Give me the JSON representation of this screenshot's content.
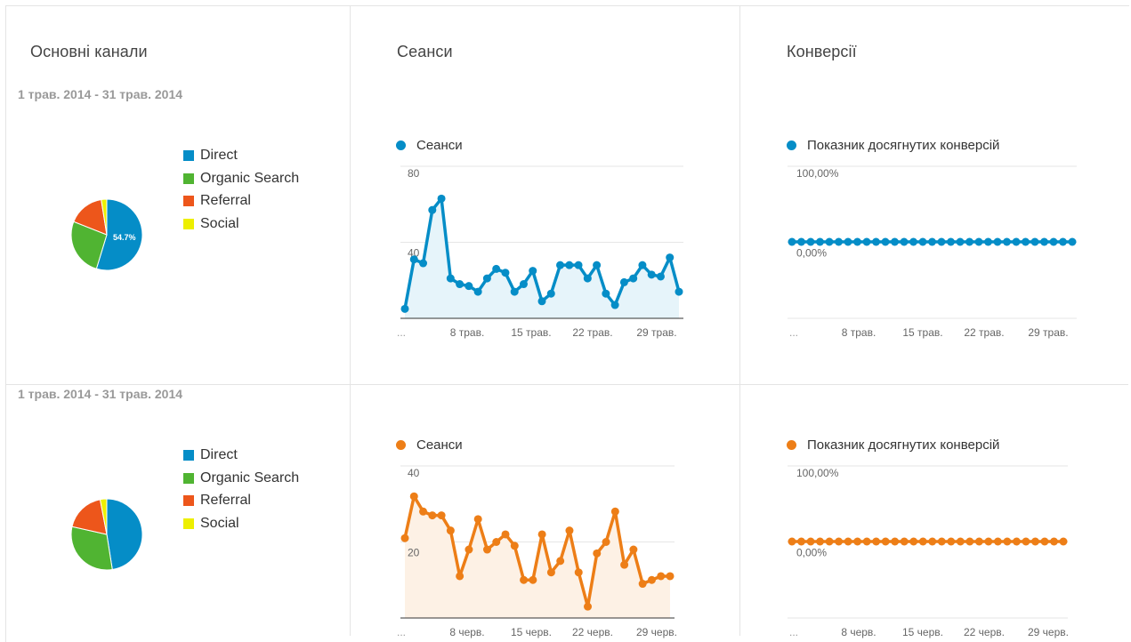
{
  "colors": {
    "direct": "#058dc7",
    "organic": "#50b432",
    "referral": "#ed561b",
    "social": "#edef00",
    "blue": "#058dc7",
    "orange": "#ed7e17",
    "blue_fill": "#e6f4fa",
    "orange_fill": "#fdf1e5"
  },
  "columns": {
    "channels_title": "Основні канали",
    "sessions_title": "Сеанси",
    "conversions_title": "Конверсії"
  },
  "rows": [
    {
      "date_range": "1 трав. 2014 - 31 трав. 2014",
      "pie_legend": [
        "Direct",
        "Organic Search",
        "Referral",
        "Social"
      ],
      "pie_label": "54.7%",
      "sessions_legend": "Сеанси",
      "conversions_legend": "Показник досягнутих конверсій"
    },
    {
      "date_range": "1 трав. 2014 - 31 трав. 2014",
      "pie_legend": [
        "Direct",
        "Organic Search",
        "Referral",
        "Social"
      ],
      "pie_label": "",
      "sessions_legend": "Сеанси",
      "conversions_legend": "Показник досягнутих конверсій"
    }
  ],
  "chart_data": [
    {
      "type": "pie",
      "categories": [
        "Direct",
        "Organic Search",
        "Referral",
        "Social"
      ],
      "values": [
        54.7,
        26.3,
        16.5,
        2.5
      ],
      "data_labels": [
        "54.7%"
      ]
    },
    {
      "type": "area",
      "legend": [
        "Сеанси"
      ],
      "y_ticks": [
        "80",
        "40"
      ],
      "ylim": [
        0,
        80
      ],
      "x_ticks": [
        "...",
        "8 трав.",
        "15 трав.",
        "22 трав.",
        "29 трав."
      ],
      "series": [
        {
          "name": "Сеанси",
          "values": [
            5,
            31,
            29,
            57,
            63,
            21,
            18,
            17,
            14,
            21,
            26,
            24,
            14,
            18,
            25,
            9,
            13,
            28,
            28,
            28,
            21,
            28,
            13,
            7,
            19,
            21,
            28,
            23,
            22,
            32,
            14
          ]
        }
      ]
    },
    {
      "type": "line",
      "legend": [
        "Показник досягнутих конверсій"
      ],
      "y_ticks": [
        "100,00%",
        "0,00%"
      ],
      "ylim": [
        0,
        100
      ],
      "x_ticks": [
        "...",
        "8 трав.",
        "15 трав.",
        "22 трав.",
        "29 трав."
      ],
      "series": [
        {
          "name": "Показник досягнутих конверсій",
          "values": [
            0,
            0,
            0,
            0,
            0,
            0,
            0,
            0,
            0,
            0,
            0,
            0,
            0,
            0,
            0,
            0,
            0,
            0,
            0,
            0,
            0,
            0,
            0,
            0,
            0,
            0,
            0,
            0,
            0,
            0,
            0
          ]
        }
      ]
    },
    {
      "type": "pie",
      "categories": [
        "Direct",
        "Organic Search",
        "Referral",
        "Social"
      ],
      "values": [
        47.5,
        31,
        18.5,
        3
      ]
    },
    {
      "type": "area",
      "legend": [
        "Сеанси"
      ],
      "y_ticks": [
        "40",
        "20"
      ],
      "ylim": [
        0,
        40
      ],
      "x_ticks": [
        "...",
        "8 черв.",
        "15 черв.",
        "22 черв.",
        "29 черв."
      ],
      "series": [
        {
          "name": "Сеанси",
          "values": [
            21,
            32,
            28,
            27,
            27,
            23,
            11,
            18,
            26,
            18,
            20,
            22,
            19,
            10,
            10,
            22,
            12,
            15,
            23,
            12,
            3,
            17,
            20,
            28,
            14,
            18,
            9,
            10,
            11,
            11
          ]
        }
      ]
    },
    {
      "type": "line",
      "legend": [
        "Показник досягнутих конверсій"
      ],
      "y_ticks": [
        "100,00%",
        "0,00%"
      ],
      "ylim": [
        0,
        100
      ],
      "x_ticks": [
        "...",
        "8 черв.",
        "15 черв.",
        "22 черв.",
        "29 черв."
      ],
      "series": [
        {
          "name": "Показник досягнутих конверсій",
          "values": [
            0,
            0,
            0,
            0,
            0,
            0,
            0,
            0,
            0,
            0,
            0,
            0,
            0,
            0,
            0,
            0,
            0,
            0,
            0,
            0,
            0,
            0,
            0,
            0,
            0,
            0,
            0,
            0,
            0,
            0
          ]
        }
      ]
    }
  ]
}
